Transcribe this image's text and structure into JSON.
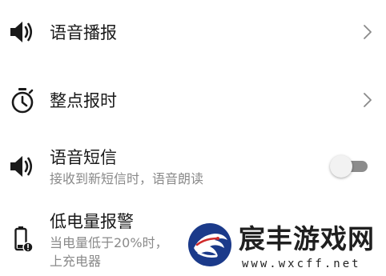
{
  "settings": {
    "items": [
      {
        "title": "语音播报",
        "icon": "speaker-icon",
        "control": "chevron"
      },
      {
        "title": "整点报时",
        "icon": "stopwatch-icon",
        "control": "chevron"
      },
      {
        "title": "语音短信",
        "subtitle": "接收到新短信时，语音朗读",
        "icon": "speaker-icon",
        "control": "toggle",
        "toggle_on": false
      },
      {
        "title": "低电量报警",
        "subtitle_line1": "当电量低于20%时，",
        "subtitle_line2": "上充电器",
        "icon": "low-battery-icon"
      }
    ]
  },
  "watermark": {
    "name": "宸丰游戏网",
    "url": "www.wxcff.net",
    "accent_color": "#1b3a8a"
  },
  "colors": {
    "text_primary": "#1a1a1a",
    "text_secondary": "#8a8a8a",
    "chevron": "#8a8a8a",
    "toggle_track_off": "#8c8c8c"
  }
}
